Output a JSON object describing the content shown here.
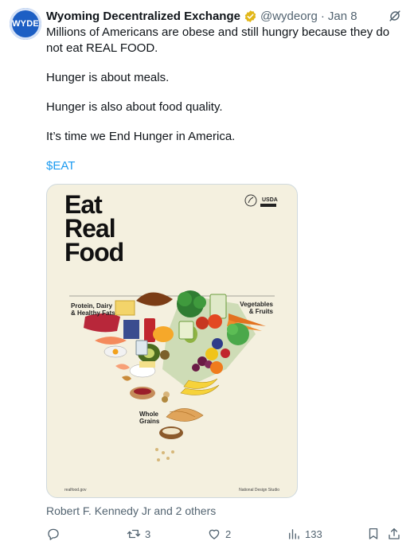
{
  "tweet": {
    "avatar_text": "WYDE",
    "author_name": "Wyoming Decentralized Exchange",
    "handle": "@wydeorg",
    "separator": "·",
    "date": "Jan 8",
    "paragraphs": [
      "Millions of Americans are obese and still hungry because they do not eat REAL FOOD.",
      "Hunger is about meals.",
      "Hunger is also about food quality.",
      "It’s time we End Hunger in America."
    ],
    "cashtag": "$EAT"
  },
  "poster": {
    "title_line1": "Eat",
    "title_line2": "Real",
    "title_line3": "Food",
    "usda": "USDA",
    "protein_label_1": "Protein, Dairy",
    "protein_label_2": "& Healthy Fats",
    "veg_label_1": "Vegetables",
    "veg_label_2": "& Fruits",
    "grains_label_1": "Whole",
    "grains_label_2": "Grains",
    "footer_left": "realfood.gov",
    "footer_right": "National Design Studio"
  },
  "liked_by": "Robert F. Kennedy Jr and 2 others",
  "actions": {
    "replies": "",
    "reposts": "3",
    "likes": "2",
    "views": "133"
  },
  "colors": {
    "accent": "#1d9bf0",
    "muted": "#536471",
    "verified_gold": "#e2b719",
    "avatar_blue": "#1d5fc4"
  }
}
